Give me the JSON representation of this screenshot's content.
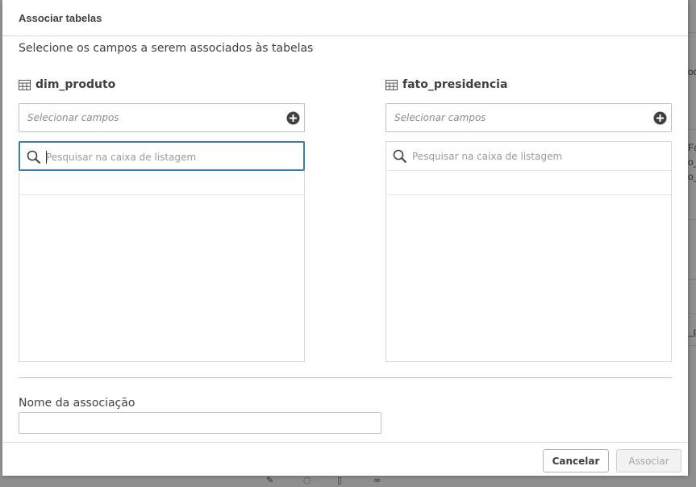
{
  "dialog": {
    "title": "Associar tabelas",
    "subtitle": "Selecione os campos a serem associados às tabelas"
  },
  "left_table": {
    "name": "dim_produto",
    "select_placeholder": "Selecionar campos",
    "search_placeholder": "Pesquisar na caixa de listagem"
  },
  "right_table": {
    "name": "fato_presidencia",
    "select_placeholder": "Selecionar campos",
    "search_placeholder": "Pesquisar na caixa de listagem"
  },
  "association": {
    "label": "Nome da associação",
    "value": ""
  },
  "footer": {
    "cancel_label": "Cancelar",
    "associate_label": "Associar"
  },
  "background": {
    "fragments": [
      "oc",
      "Fa",
      "o_",
      "o_",
      "_p"
    ]
  },
  "colors": {
    "focus_border": "#3f7fa6",
    "disabled_text": "#a6a6a6"
  }
}
